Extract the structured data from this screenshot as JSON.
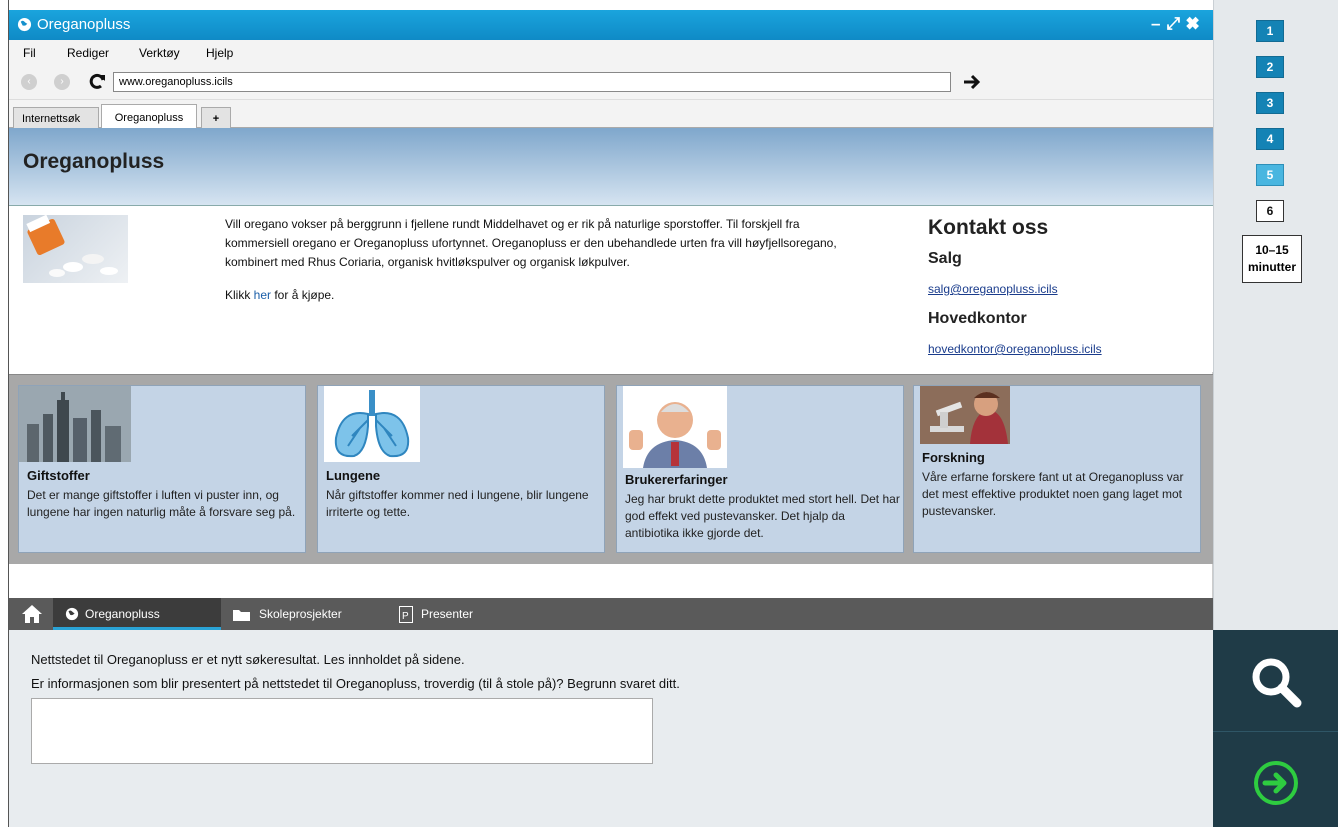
{
  "window": {
    "title": "Oreganopluss"
  },
  "menu": {
    "items": [
      "Fil",
      "Rediger",
      "Verktøy",
      "Hjelp"
    ]
  },
  "address": {
    "url": "www.oreganopluss.icils"
  },
  "browser_tabs": [
    {
      "label": "Internettsøk",
      "active": false
    },
    {
      "label": "Oreganopluss",
      "active": true
    },
    {
      "label": "+",
      "active": false
    }
  ],
  "page": {
    "title": "Oreganopluss",
    "intro": "Vill oregano vokser på berggrunn i fjellene rundt Middelhavet og er rik på naturlige sporstoffer. Til forskjell fra kommersiell oregano er Oreganopluss ufortynnet. Oreganopluss er den ubehandlede urten fra vill høyfjellsoregano, kombinert med Rhus Coriaria, organisk hvitløkspulver og organisk løkpulver.",
    "buy_prefix": "Klikk ",
    "buy_link": "her",
    "buy_suffix": " for å kjøpe."
  },
  "contact": {
    "heading": "Kontakt oss",
    "sales_heading": "Salg",
    "sales_email": "salg@oreganopluss.icils",
    "hq_heading": "Hovedkontor",
    "hq_email": "hovedkontor@oreganopluss.icils"
  },
  "cards": [
    {
      "title": "Giftstoffer",
      "text": "Det er mange giftstoffer i luften vi puster inn, og lungene har ingen naturlig måte å forsvare seg på."
    },
    {
      "title": "Lungene",
      "text": "Når giftstoffer kommer ned i lungene, blir lungene irriterte og tette."
    },
    {
      "title": "Brukererfaringer",
      "text": "Jeg har brukt dette produktet med stort hell. Det har god effekt ved pustevansker. Det hjalp da antibiotika ikke gjorde det."
    },
    {
      "title": "Forskning",
      "text": "Våre erfarne forskere fant ut at Oreganopluss var det mest effektive produktet noen gang laget mot pustevansker."
    }
  ],
  "task_tabs": [
    {
      "label": "Oreganopluss",
      "active": true
    },
    {
      "label": "Skoleprosjekter",
      "active": false
    },
    {
      "label": "Presenter",
      "active": false
    }
  ],
  "question": {
    "line1": "Nettstedet til Oreganopluss er et nytt søkeresultat. Les innholdet på sidene.",
    "line2": "Er informasjonen som blir presentert på nettstedet til Oreganopluss, troverdig (til å stole på)? Begrunn svaret ditt.",
    "answer": ""
  },
  "steps": [
    "1",
    "2",
    "3",
    "4",
    "5",
    "6"
  ],
  "current_step": "5",
  "time": {
    "range": "10–15",
    "unit": "minutter"
  },
  "colors": {
    "titlebar": "#1aa4dd",
    "step_done": "#1483b5",
    "step_current": "#49b6e0",
    "dark_panel": "#1f3b47",
    "next_green": "#2ecc40"
  }
}
